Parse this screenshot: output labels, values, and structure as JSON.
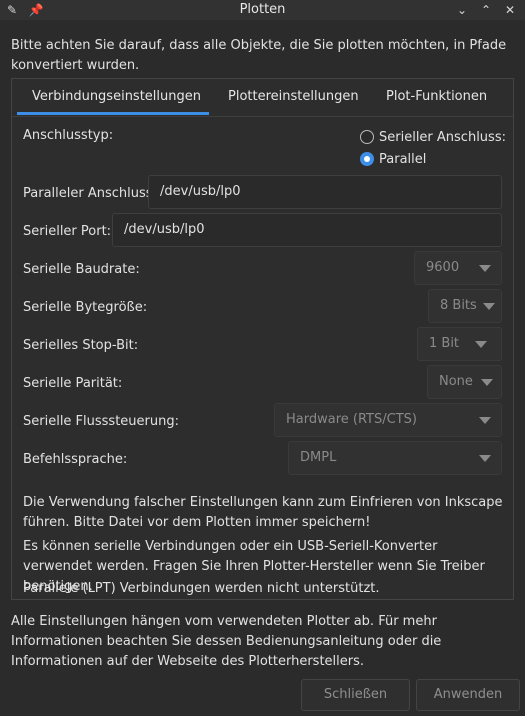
{
  "window": {
    "title": "Plotten"
  },
  "intro": "Bitte achten Sie darauf, dass alle Objekte, die Sie plotten möchten, in Pfade konvertiert wurden.",
  "tabs": [
    {
      "label": "Verbindungseinstellungen"
    },
    {
      "label": "Plottereinstellungen"
    },
    {
      "label": "Plot-Funktionen"
    }
  ],
  "connection": {
    "type_label": "Anschlusstyp:",
    "radio_serial": "Serieller Anschluss:",
    "radio_parallel": "Parallel",
    "parallel_label": "Paralleler Anschluss:",
    "parallel_value": "/dev/usb/lp0",
    "serial_port_label": "Serieller Port:",
    "serial_port_value": "/dev/usb/lp0",
    "baud_label": "Serielle Baudrate:",
    "baud_value": "9600",
    "bytesize_label": "Serielle Bytegröße:",
    "bytesize_value": "8 Bits",
    "stopbit_label": "Serielles Stop-Bit:",
    "stopbit_value": "1 Bit",
    "parity_label": "Serielle Parität:",
    "parity_value": "None",
    "flow_label": "Serielle Flusssteuerung:",
    "flow_value": "Hardware (RTS/CTS)",
    "command_label": "Befehlssprache:",
    "command_value": "DMPL",
    "note1": "Die Verwendung falscher Einstellungen kann zum Einfrieren von Inkscape führen. Bitte Datei vor dem Plotten immer speichern!",
    "note2": "Es können serielle Verbindungen oder ein USB-Seriell-Konverter verwendet werden. Fragen Sie Ihren Plotter-Hersteller wenn Sie Treiber benötigen.",
    "note3": "Parallele (LPT) Verbindungen werden nicht unterstützt."
  },
  "footer": "Alle Einstellungen hängen vom verwendeten Plotter ab. Für mehr Informationen beachten Sie dessen Bedienungsanleitung oder die Informationen auf der Webseite des Plotterherstellers.",
  "buttons": {
    "close": "Schließen",
    "apply": "Anwenden"
  }
}
